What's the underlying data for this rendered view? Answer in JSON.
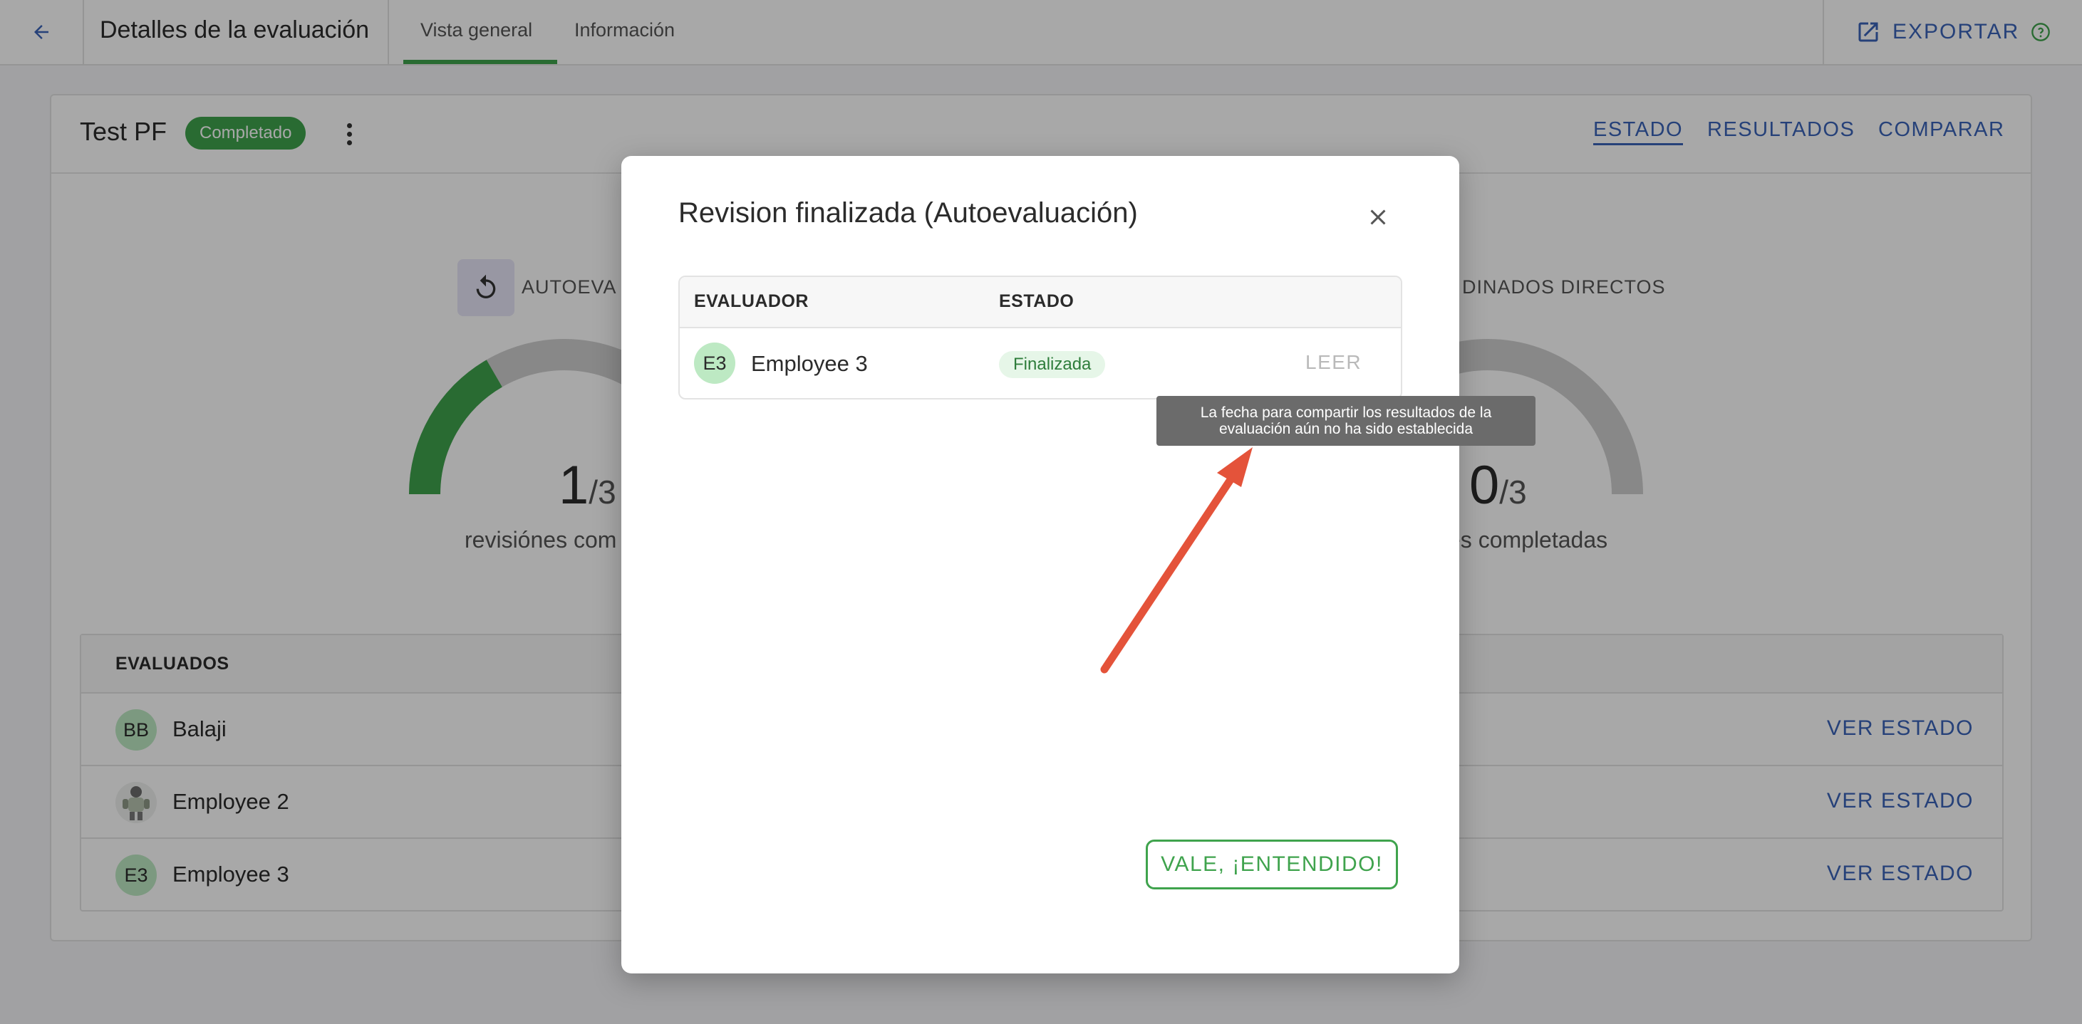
{
  "topbar": {
    "title": "Detalles de la evaluación",
    "tabs": [
      {
        "label": "Vista general",
        "active": true
      },
      {
        "label": "Información",
        "active": false
      }
    ],
    "export_label": "EXPORTAR"
  },
  "card": {
    "title": "Test PF",
    "status_badge": "Completado",
    "header_links": [
      {
        "label": "ESTADO",
        "active": true
      },
      {
        "label": "RESULTADOS",
        "active": false
      },
      {
        "label": "COMPARAR",
        "active": false
      }
    ],
    "stats": {
      "self": {
        "title": "AUTOEVA",
        "completed": "1",
        "total": "3",
        "caption": "revisiónes com",
        "progress": 0.333
      },
      "direct_reports": {
        "title": "DINADOS DIRECTOS",
        "completed": "0",
        "total": "3",
        "caption": "es completadas",
        "progress": 0.0
      }
    },
    "table": {
      "header": "EVALUADOS",
      "rows": [
        {
          "initials": "BB",
          "name": "Balaji",
          "link": "VER ESTADO"
        },
        {
          "initials": "",
          "name": "Employee 2",
          "link": "VER ESTADO",
          "photo": true
        },
        {
          "initials": "E3",
          "name": "Employee 3",
          "link": "VER ESTADO"
        }
      ]
    }
  },
  "modal": {
    "title": "Revision finalizada (Autoevaluación)",
    "columns": [
      "EVALUADOR",
      "ESTADO"
    ],
    "row": {
      "initials": "E3",
      "name": "Employee 3",
      "status": "Finalizada",
      "action": "LEER"
    },
    "tooltip": "La fecha para compartir los resultados de la evaluación aún no ha sido establecida",
    "ok_button": "VALE, ¡ENTENDIDO!"
  },
  "colors": {
    "accent_green": "#3fa34d",
    "link_blue": "#3a63b8",
    "annotation_arrow": "#e4533a"
  },
  "icons": [
    "back-arrow-icon",
    "export-icon",
    "help-icon",
    "more-vert-icon",
    "reset-icon",
    "close-icon"
  ]
}
